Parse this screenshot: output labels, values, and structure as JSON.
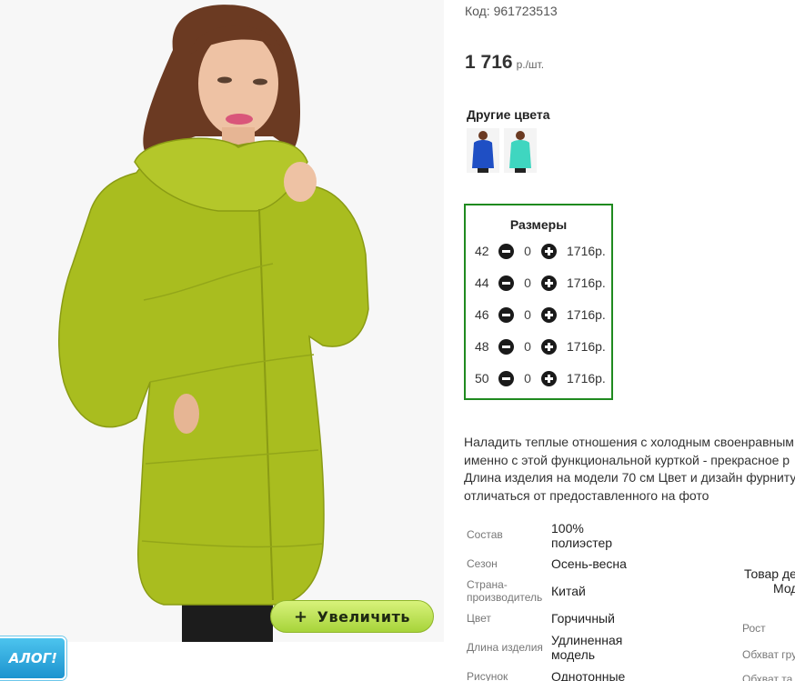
{
  "product": {
    "code": "Код: 961723513",
    "price": "1 716",
    "price_unit": "р./шт."
  },
  "photo": {
    "zoom_label": "Увеличить",
    "zoom_plus": "+",
    "catalog_badge": "АЛОГ!",
    "jacket_color": "#a9bd1f"
  },
  "other_colors": {
    "title": "Другие цвета",
    "swatches": [
      {
        "color": "#1f4fc4"
      },
      {
        "color": "#3fd6c0"
      }
    ]
  },
  "sizes": {
    "title": "Размеры",
    "rows": [
      {
        "size": "42",
        "qty": "0",
        "price": "1716р."
      },
      {
        "size": "44",
        "qty": "0",
        "price": "1716р."
      },
      {
        "size": "46",
        "qty": "0",
        "price": "1716р."
      },
      {
        "size": "48",
        "qty": "0",
        "price": "1716р."
      },
      {
        "size": "50",
        "qty": "0",
        "price": "1716р."
      }
    ],
    "border_color": "#1f8a1f"
  },
  "description": {
    "lines": [
      "Наладить теплые отношения с холодным своенравным",
      "именно с этой функциональной курткой - прекрасное р",
      "Длина изделия на модели 70 см Цвет и дизайн фурниту",
      "отличаться от предоставленного на фото"
    ]
  },
  "attributes": [
    {
      "label": "Состав",
      "value": "100%\nполиэстер"
    },
    {
      "label": "Сезон",
      "value": "Осень-весна"
    },
    {
      "label": "Страна-\nпроизводитель",
      "value": "Китай"
    },
    {
      "label": "Цвет",
      "value": "Горчичный"
    },
    {
      "label": "Длина изделия",
      "value": "Удлиненная\nмодель"
    },
    {
      "label": "Рисунок",
      "value": "Однотонные"
    }
  ],
  "side_panel": {
    "heading_line1": "Товар де",
    "heading_line2": "Мод",
    "labels": [
      "Рост",
      "Обхват гру",
      "Обхват та"
    ]
  }
}
